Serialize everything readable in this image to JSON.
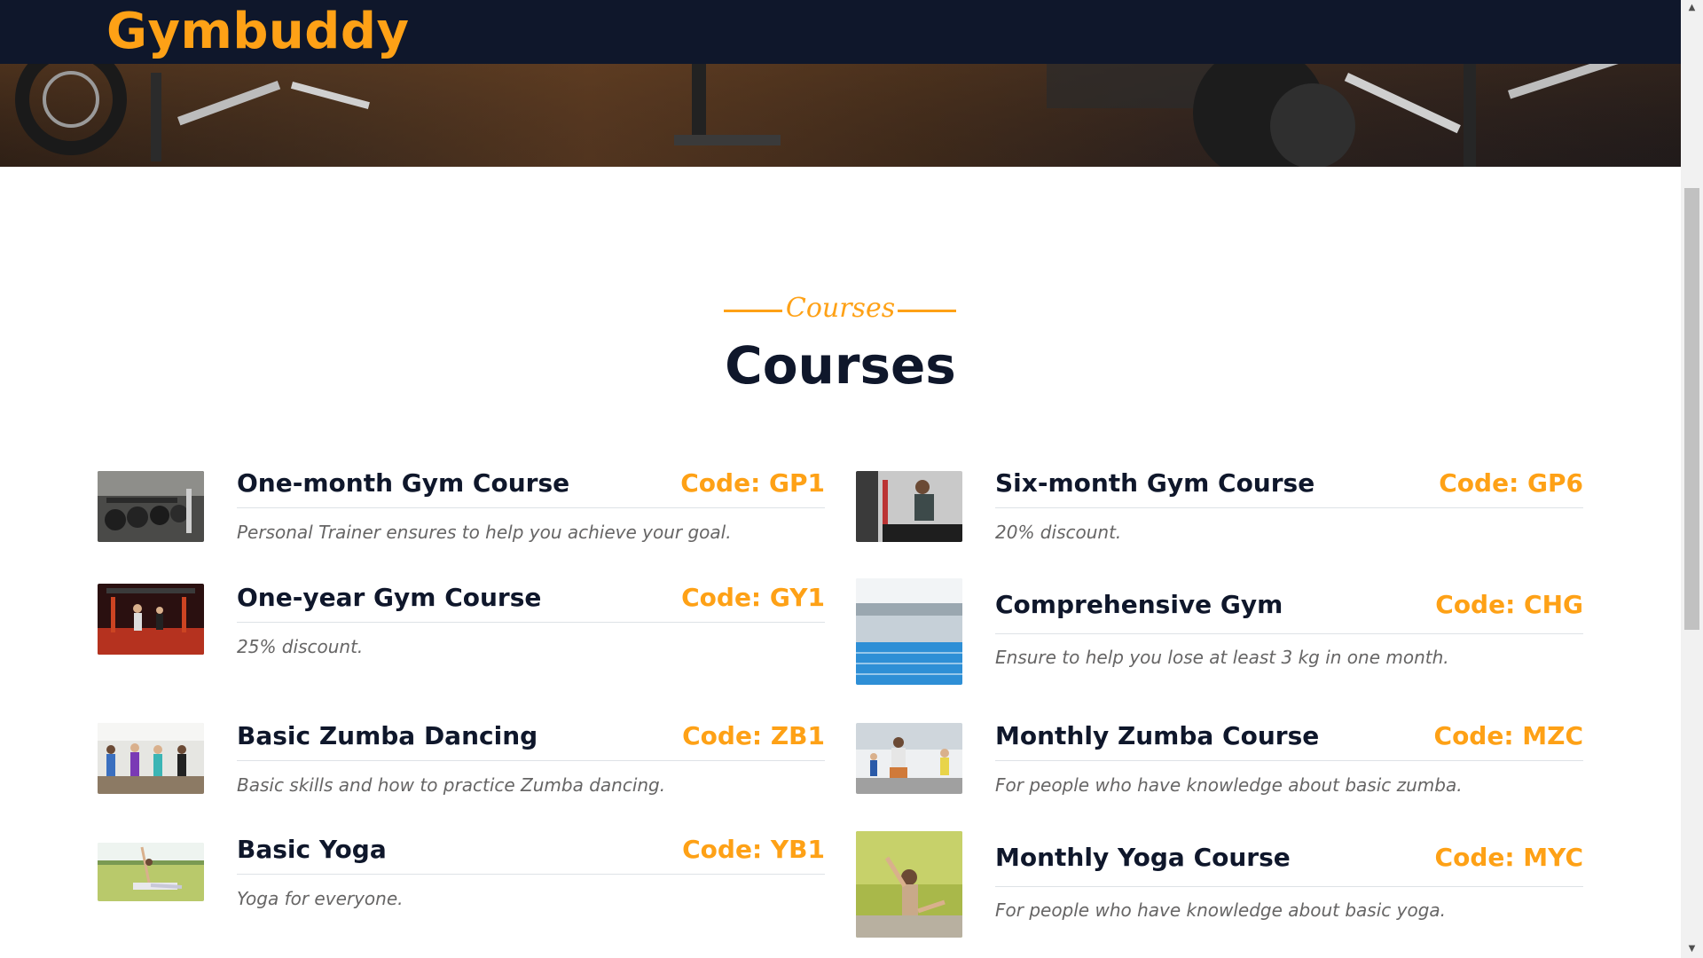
{
  "brand": {
    "name": "Gymbuddy",
    "color": "#fea116",
    "nav_bg": "#0f172b"
  },
  "section": {
    "subtitle": "Courses",
    "title": "Courses"
  },
  "courses": [
    {
      "name": "One-month Gym Course",
      "code": "Code: GP1",
      "description": "Personal Trainer ensures to help you achieve your goal.",
      "image": "gym-dumbbells-photo"
    },
    {
      "name": "Six-month Gym Course",
      "code": "Code: GP6",
      "description": "20% discount.",
      "image": "treadmill-runner-photo"
    },
    {
      "name": "One-year Gym Course",
      "code": "Code: GY1",
      "description": "25% discount.",
      "image": "red-gym-interior-photo"
    },
    {
      "name": "Comprehensive Gym",
      "code": "Code: CHG",
      "description": "Ensure to help you lose at least 3 kg in one month.",
      "image": "swimming-pool-photo"
    },
    {
      "name": "Basic Zumba Dancing",
      "code": "Code: ZB1",
      "description": "Basic skills and how to practice Zumba dancing.",
      "image": "zumba-class-photo"
    },
    {
      "name": "Monthly Zumba Course",
      "code": "Code: MZC",
      "description": "For people who have knowledge about basic zumba.",
      "image": "zumba-instructor-photo"
    },
    {
      "name": "Basic Yoga",
      "code": "Code: YB1",
      "description": "Yoga for everyone.",
      "image": "yoga-outdoor-photo"
    },
    {
      "name": "Monthly Yoga Course",
      "code": "Code: MYC",
      "description": "For people who have knowledge about basic yoga.",
      "image": "yoga-pose-photo"
    }
  ]
}
